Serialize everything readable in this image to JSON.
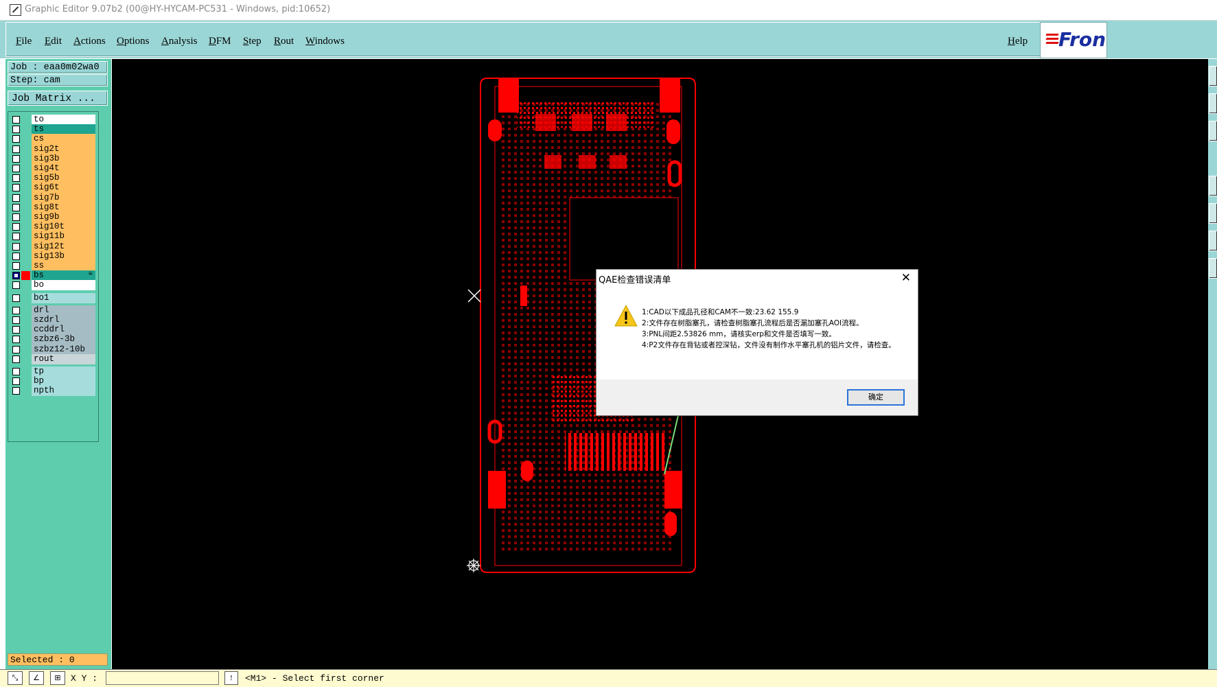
{
  "window": {
    "title": "Graphic Editor 9.07b2 (00@HY-HYCAM-PC531 - Windows, pid:10652)"
  },
  "menubar": {
    "items": [
      "File",
      "Edit",
      "Actions",
      "Options",
      "Analysis",
      "DFM",
      "Step",
      "Rout",
      "Windows"
    ],
    "help": "Help",
    "logo_text": "Fron"
  },
  "left_panel": {
    "job": "Job : eaa0m02wa0",
    "step": "Step: cam",
    "job_matrix": "Job Matrix ...",
    "layers": [
      {
        "name": "to",
        "color": "#ffffff"
      },
      {
        "name": "ts",
        "color": "#1fa590"
      },
      {
        "name": "cs",
        "color": "#ffbf60"
      },
      {
        "name": "sig2t",
        "color": "#ffbf60"
      },
      {
        "name": "sig3b",
        "color": "#ffbf60"
      },
      {
        "name": "sig4t",
        "color": "#ffbf60"
      },
      {
        "name": "sig5b",
        "color": "#ffbf60"
      },
      {
        "name": "sig6t",
        "color": "#ffbf60"
      },
      {
        "name": "sig7b",
        "color": "#ffbf60"
      },
      {
        "name": "sig8t",
        "color": "#ffbf60"
      },
      {
        "name": "sig9b",
        "color": "#ffbf60"
      },
      {
        "name": "sig10t",
        "color": "#ffbf60"
      },
      {
        "name": "sig11b",
        "color": "#ffbf60"
      },
      {
        "name": "sig12t",
        "color": "#ffbf60"
      },
      {
        "name": "sig13b",
        "color": "#ffbf60"
      },
      {
        "name": "ss",
        "color": "#ffbf60"
      },
      {
        "name": "bs",
        "color": "#1fa590",
        "active": true,
        "display_color": "#ff0000",
        "marker": "≡"
      },
      {
        "name": "bo",
        "color": "#ffffff"
      },
      {
        "name": "bo1",
        "color": "#a6dcdc"
      },
      {
        "name": "drl",
        "color": "#a6bcc4"
      },
      {
        "name": "szdrl",
        "color": "#a6bcc4"
      },
      {
        "name": "ccddrl",
        "color": "#a6bcc4"
      },
      {
        "name": "szbz6-3b",
        "color": "#a6bcc4"
      },
      {
        "name": "szbz12-10b",
        "color": "#a6bcc4"
      },
      {
        "name": "rout",
        "color": "#c8d6da"
      },
      {
        "name": "tp",
        "color": "#a6dcdc"
      },
      {
        "name": "bp",
        "color": "#a6dcdc"
      },
      {
        "name": "npth",
        "color": "#a6dcdc"
      }
    ],
    "selected": "Selected : 0"
  },
  "statusbar": {
    "xy_label": "X Y :",
    "xy_value": "",
    "message": "<M1> - Select first corner"
  },
  "dialog": {
    "title": "QAE检查错误清单",
    "messages": [
      "1:CAD以下成品孔径和CAM不一致:23.62 155.9",
      "2:文件存在树脂塞孔，请检查树脂塞孔流程后是否漏加塞孔AOI流程。",
      "3:PNL间距2.53826 mm，请核实erp和文件是否填写一致。",
      "4:P2文件存在背钻或者控深钻，文件没有制作水平塞孔机的铝片文件，请检查。"
    ],
    "ok_button": "确定"
  },
  "colors": {
    "menu_bg": "#9bd6d6",
    "panel_bg": "#5ecdae",
    "canvas_bg": "#000000",
    "board_red": "#ff0000",
    "arrow_green": "#7be07b",
    "status_bg": "#fffbd0"
  }
}
